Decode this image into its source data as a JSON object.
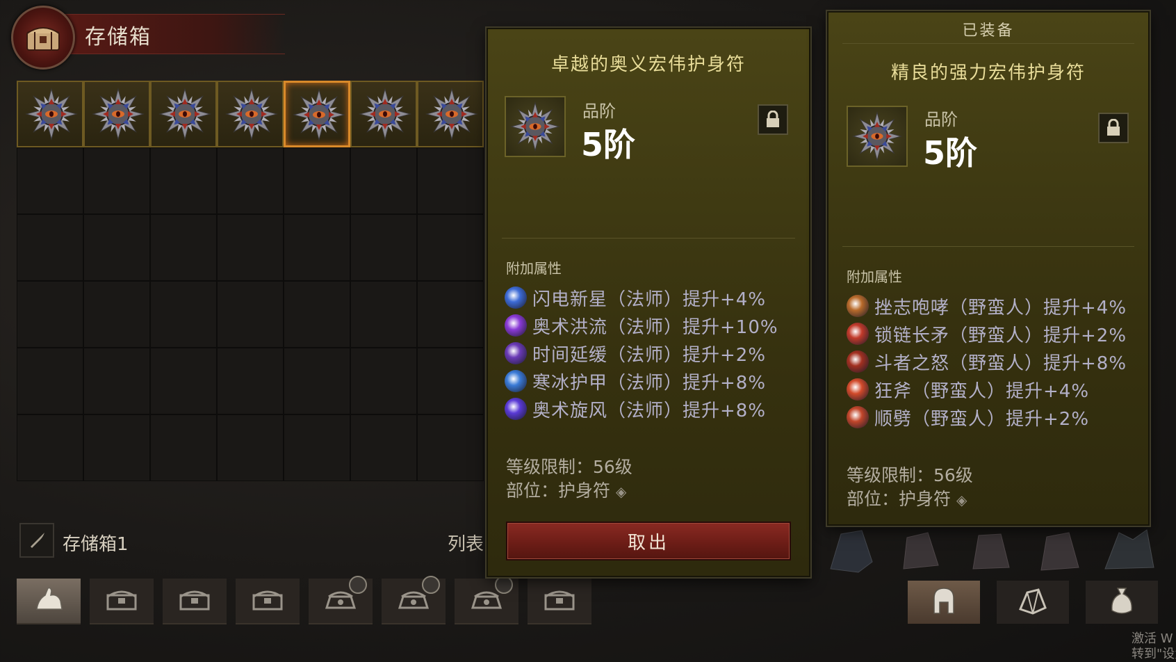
{
  "stash": {
    "title": "存储箱",
    "name": "存储箱1",
    "list_label": "列表",
    "filled_slots": 7,
    "selected_slot": 5
  },
  "tooltip_selected": {
    "name": "卓越的奥义宏伟护身符",
    "grade_label": "品阶",
    "grade_value": "5阶",
    "affix_header": "附加属性",
    "affixes": [
      {
        "text": "闪电新星（法师）提升+4%",
        "icon": "lightning-nova-icon",
        "color": "#3d6bd6"
      },
      {
        "text": "奥术洪流（法师）提升+10%",
        "icon": "arcane-torrent-icon",
        "color": "#8a3ad6"
      },
      {
        "text": "时间延缓（法师）提升+2%",
        "icon": "slow-time-icon",
        "color": "#6a3ab6"
      },
      {
        "text": "寒冰护甲（法师）提升+8%",
        "icon": "ice-armor-icon",
        "color": "#3a7ad6"
      },
      {
        "text": "奥术旋风（法师）提升+8%",
        "icon": "arcane-vortex-icon",
        "color": "#5a3ad6"
      }
    ],
    "level_req": "等级限制：56级",
    "slot": "部位：护身符",
    "action": "取出"
  },
  "tooltip_equipped": {
    "header": "已装备",
    "name": "精良的强力宏伟护身符",
    "grade_label": "品阶",
    "grade_value": "5阶",
    "affix_header": "附加属性",
    "affixes": [
      {
        "text": "挫志咆哮（野蛮人）提升+4%",
        "icon": "threatening-shout-icon",
        "color": "#b86a2a"
      },
      {
        "text": "锁链长矛（野蛮人）提升+2%",
        "icon": "ancient-spear-icon",
        "color": "#c23a2a"
      },
      {
        "text": "斗者之怒（野蛮人）提升+8%",
        "icon": "wrath-icon",
        "color": "#a23020"
      },
      {
        "text": "狂斧（野蛮人）提升+4%",
        "icon": "frenzy-axe-icon",
        "color": "#d24a2a"
      },
      {
        "text": "顺劈（野蛮人）提升+2%",
        "icon": "cleave-icon",
        "color": "#c2462a"
      }
    ],
    "level_req": "等级限制：56级",
    "slot": "部位：护身符"
  },
  "tabs": [
    {
      "icon": "hand-icon",
      "active": true
    },
    {
      "icon": "chest-icon"
    },
    {
      "icon": "chest-icon"
    },
    {
      "icon": "chest-icon"
    },
    {
      "icon": "locked-chest-icon",
      "timer": true
    },
    {
      "icon": "locked-chest-icon",
      "timer": true
    },
    {
      "icon": "locked-chest-icon",
      "timer": true
    },
    {
      "icon": "chest-icon"
    }
  ],
  "right_tabs": [
    {
      "icon": "helmet-icon",
      "active": true
    },
    {
      "icon": "gem-icon"
    },
    {
      "icon": "bag-icon"
    }
  ],
  "watermark": {
    "line1": "激活 W",
    "line2": "转到\"设置"
  },
  "colors": {
    "accent": "#d98a2a",
    "tooltip_bg": "#3e3912",
    "button_red": "#7a2218",
    "affix_text": "#b3b0c8"
  }
}
